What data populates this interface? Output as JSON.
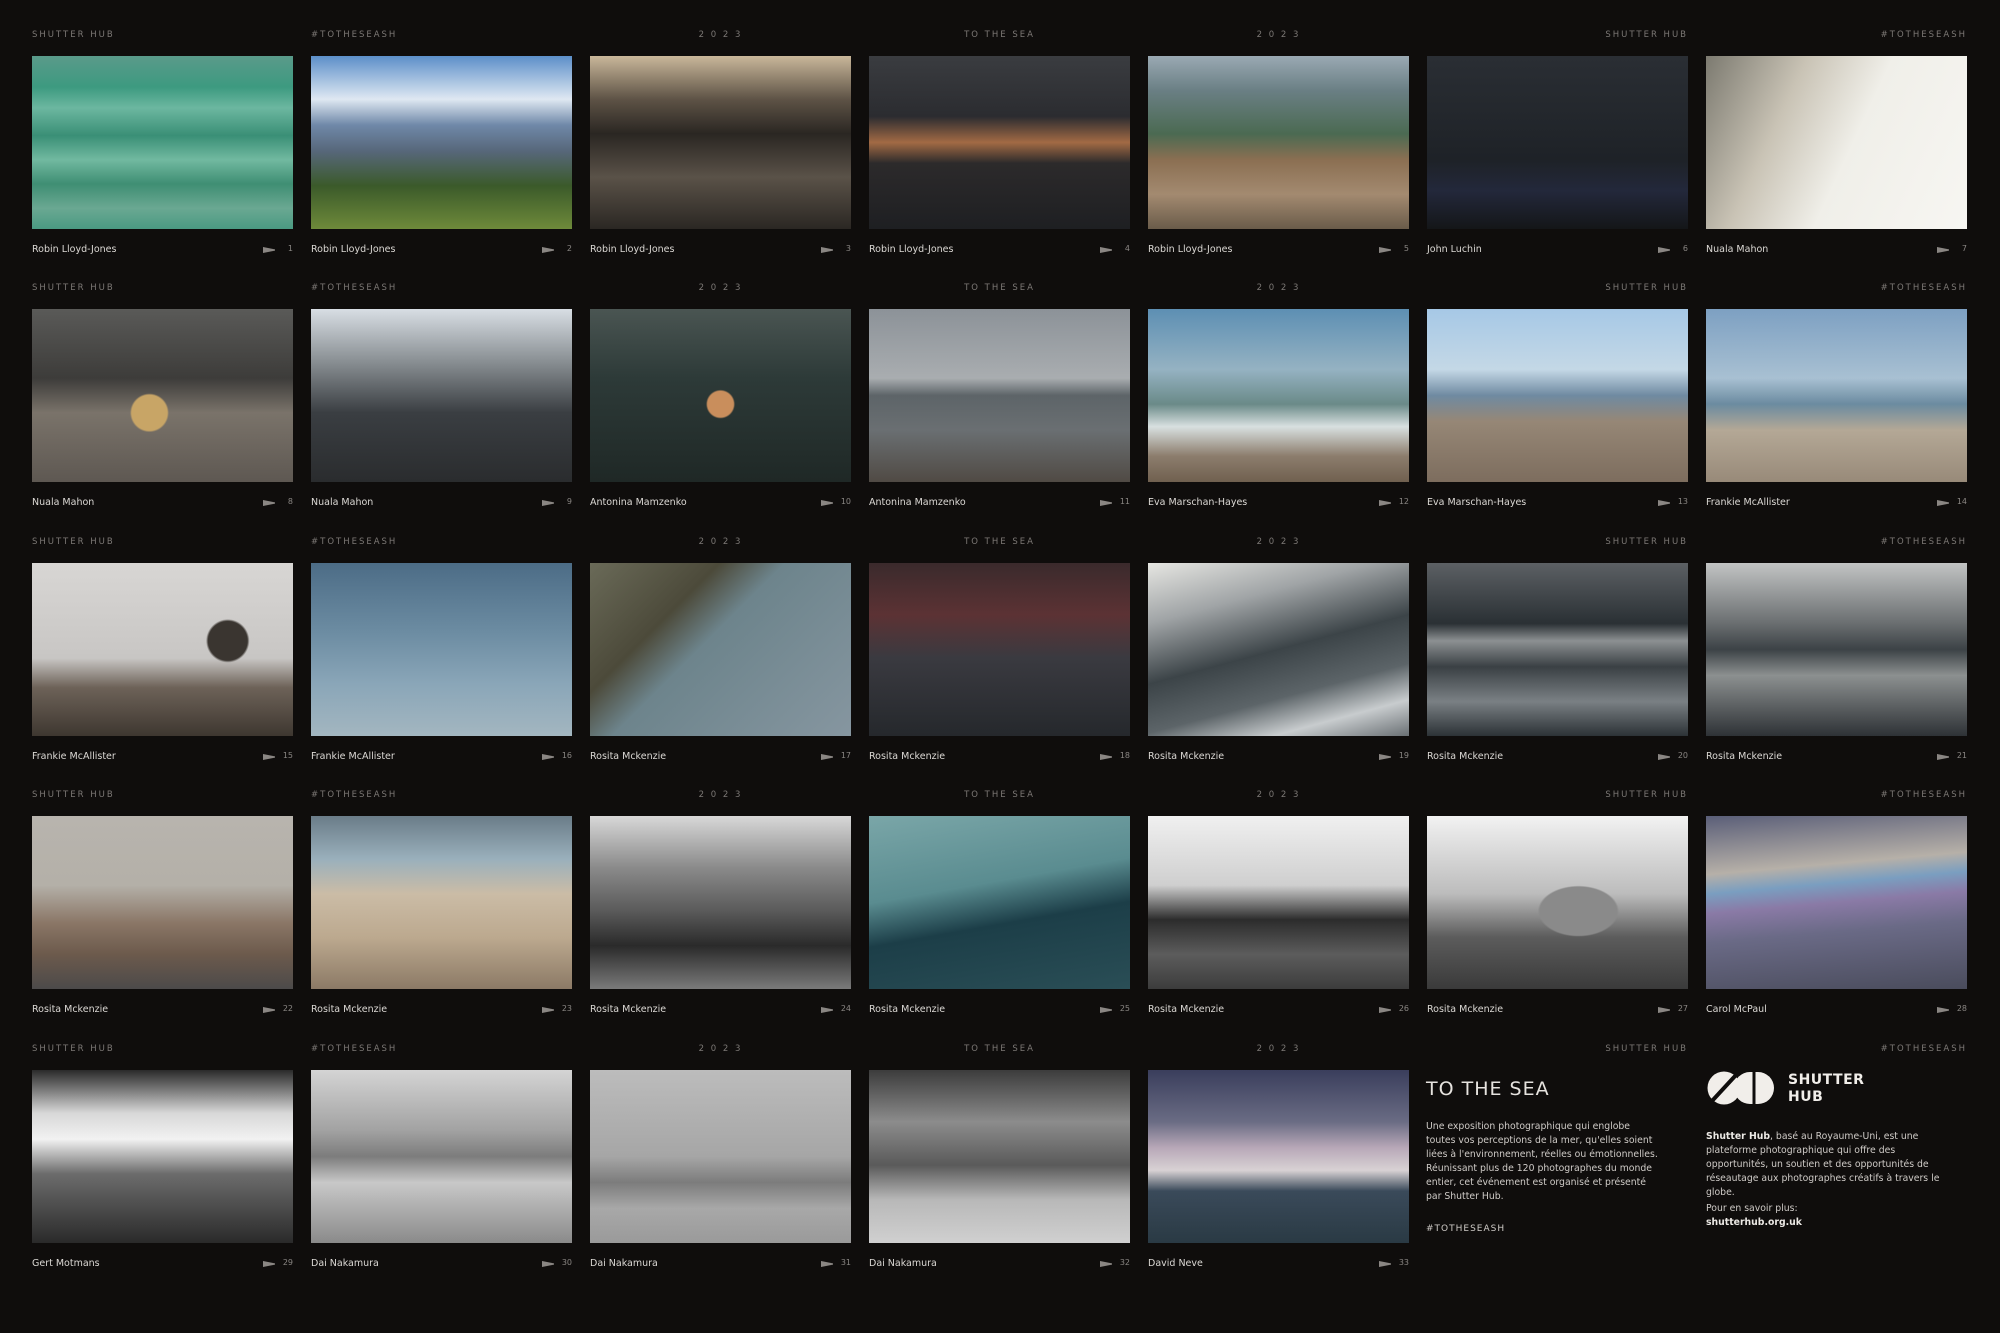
{
  "header_labels": [
    "SHUTTER HUB",
    "#TOTHESEASH",
    "2 0 2 3",
    "TO THE SEA",
    "2 0 2 3",
    "SHUTTER HUB",
    "#TOTHESEASH"
  ],
  "frames": [
    {
      "num": "1",
      "photographer": "Robin Lloyd-Jones"
    },
    {
      "num": "2",
      "photographer": "Robin Lloyd-Jones"
    },
    {
      "num": "3",
      "photographer": "Robin Lloyd-Jones"
    },
    {
      "num": "4",
      "photographer": "Robin Lloyd-Jones"
    },
    {
      "num": "5",
      "photographer": "Robin Lloyd-Jones"
    },
    {
      "num": "6",
      "photographer": "John Luchin"
    },
    {
      "num": "7",
      "photographer": "Nuala Mahon"
    },
    {
      "num": "8",
      "photographer": "Nuala Mahon"
    },
    {
      "num": "9",
      "photographer": "Nuala Mahon"
    },
    {
      "num": "10",
      "photographer": "Antonina Mamzenko"
    },
    {
      "num": "11",
      "photographer": "Antonina Mamzenko"
    },
    {
      "num": "12",
      "photographer": "Eva Marschan-Hayes"
    },
    {
      "num": "13",
      "photographer": "Eva Marschan-Hayes"
    },
    {
      "num": "14",
      "photographer": "Frankie McAllister"
    },
    {
      "num": "15",
      "photographer": "Frankie McAllister"
    },
    {
      "num": "16",
      "photographer": "Frankie McAllister"
    },
    {
      "num": "17",
      "photographer": "Rosita Mckenzie"
    },
    {
      "num": "18",
      "photographer": "Rosita Mckenzie"
    },
    {
      "num": "19",
      "photographer": "Rosita Mckenzie"
    },
    {
      "num": "20",
      "photographer": "Rosita Mckenzie"
    },
    {
      "num": "21",
      "photographer": "Rosita Mckenzie"
    },
    {
      "num": "22",
      "photographer": "Rosita Mckenzie"
    },
    {
      "num": "23",
      "photographer": "Rosita Mckenzie"
    },
    {
      "num": "24",
      "photographer": "Rosita Mckenzie"
    },
    {
      "num": "25",
      "photographer": "Rosita Mckenzie"
    },
    {
      "num": "26",
      "photographer": "Rosita Mckenzie"
    },
    {
      "num": "27",
      "photographer": "Rosita Mckenzie"
    },
    {
      "num": "28",
      "photographer": "Carol McPaul"
    },
    {
      "num": "29",
      "photographer": "Gert Motmans"
    },
    {
      "num": "30",
      "photographer": "Dai Nakamura"
    },
    {
      "num": "31",
      "photographer": "Dai Nakamura"
    },
    {
      "num": "32",
      "photographer": "Dai Nakamura"
    },
    {
      "num": "33",
      "photographer": "David Neve"
    }
  ],
  "info": {
    "title": "TO THE SEA",
    "description": "Une exposition photographique qui englobe toutes vos perceptions de la mer, qu'elles soient liées à l'environnement, réelles ou émotionnelles. Réunissant plus de 120 photographes du monde entier, cet événement est organisé et présenté par Shutter Hub.",
    "hashtag": "#TOTHESEASH",
    "logo_line1": "SHUTTER",
    "logo_line2": "HUB",
    "about_name": "Shutter Hub",
    "about_text": ", basé au Royaume-Uni, est une plateforme photographique qui offre des opportunités, un soutien et des opportunités de réseautage aux photographes créatifs à travers le globe.",
    "more_label": "Pour en savoir plus:",
    "url": "shutterhub.org.uk"
  },
  "colors": {
    "background": "#0f0d0c",
    "text": "#d9d6d2",
    "muted": "#7c7875"
  }
}
